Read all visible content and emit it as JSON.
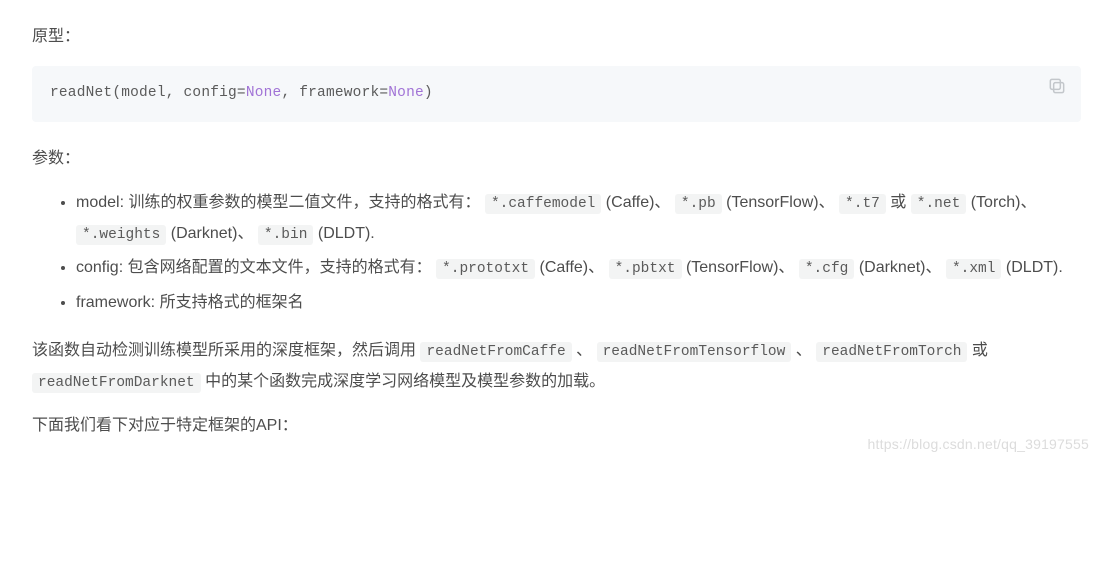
{
  "intro": {
    "prototype_label": "原型："
  },
  "code": {
    "fn": "readNet",
    "open": "(model, config=",
    "none1": "None",
    "mid": ", framework=",
    "none2": "None",
    "close": ")"
  },
  "params": {
    "heading": "参数：",
    "model": {
      "lead": "model: 训练的权重参数的模型二值文件，支持的格式有：",
      "c1": "*.caffemodel",
      "c1_sfx": " (Caffe)、 ",
      "c2": "*.pb",
      "c2_sfx": " (TensorFlow)、 ",
      "c3": "*.t7",
      "c3_sfx": " 或 ",
      "c4": "*.net",
      "c4_sfx": " (Torch)、",
      "c5": "*.weights",
      "c5_sfx": " (Darknet)、 ",
      "c6": "*.bin",
      "c6_sfx": " (DLDT)."
    },
    "config": {
      "lead": "config: 包含网络配置的文本文件，支持的格式有：",
      "c1": "*.prototxt",
      "c1_sfx": " (Caffe)、 ",
      "c2": "*.pbtxt",
      "c2_sfx": " (TensorFlow)、 ",
      "c3": "*.cfg",
      "c3_sfx": " (Darknet)、 ",
      "c4": "*.xml",
      "c4_sfx": " (DLDT)."
    },
    "framework": {
      "text": "framework: 所支持格式的框架名"
    }
  },
  "detect": {
    "p1": "该函数自动检测训练模型所采用的深度框架，然后调用",
    "f1": "readNetFromCaffe",
    "s1": " 、 ",
    "f2": "readNetFromTensorflow",
    "s2": " 、 ",
    "f3": "readNetFromTorch",
    "s3": " 或 ",
    "f4": "readNetFromDarknet",
    "p2": " 中的某个函数完成深度学习网络模型及模型参数的加载。"
  },
  "outro": {
    "text": "下面我们看下对应于特定框架的API："
  },
  "watermark": "https://blog.csdn.net/qq_39197555"
}
